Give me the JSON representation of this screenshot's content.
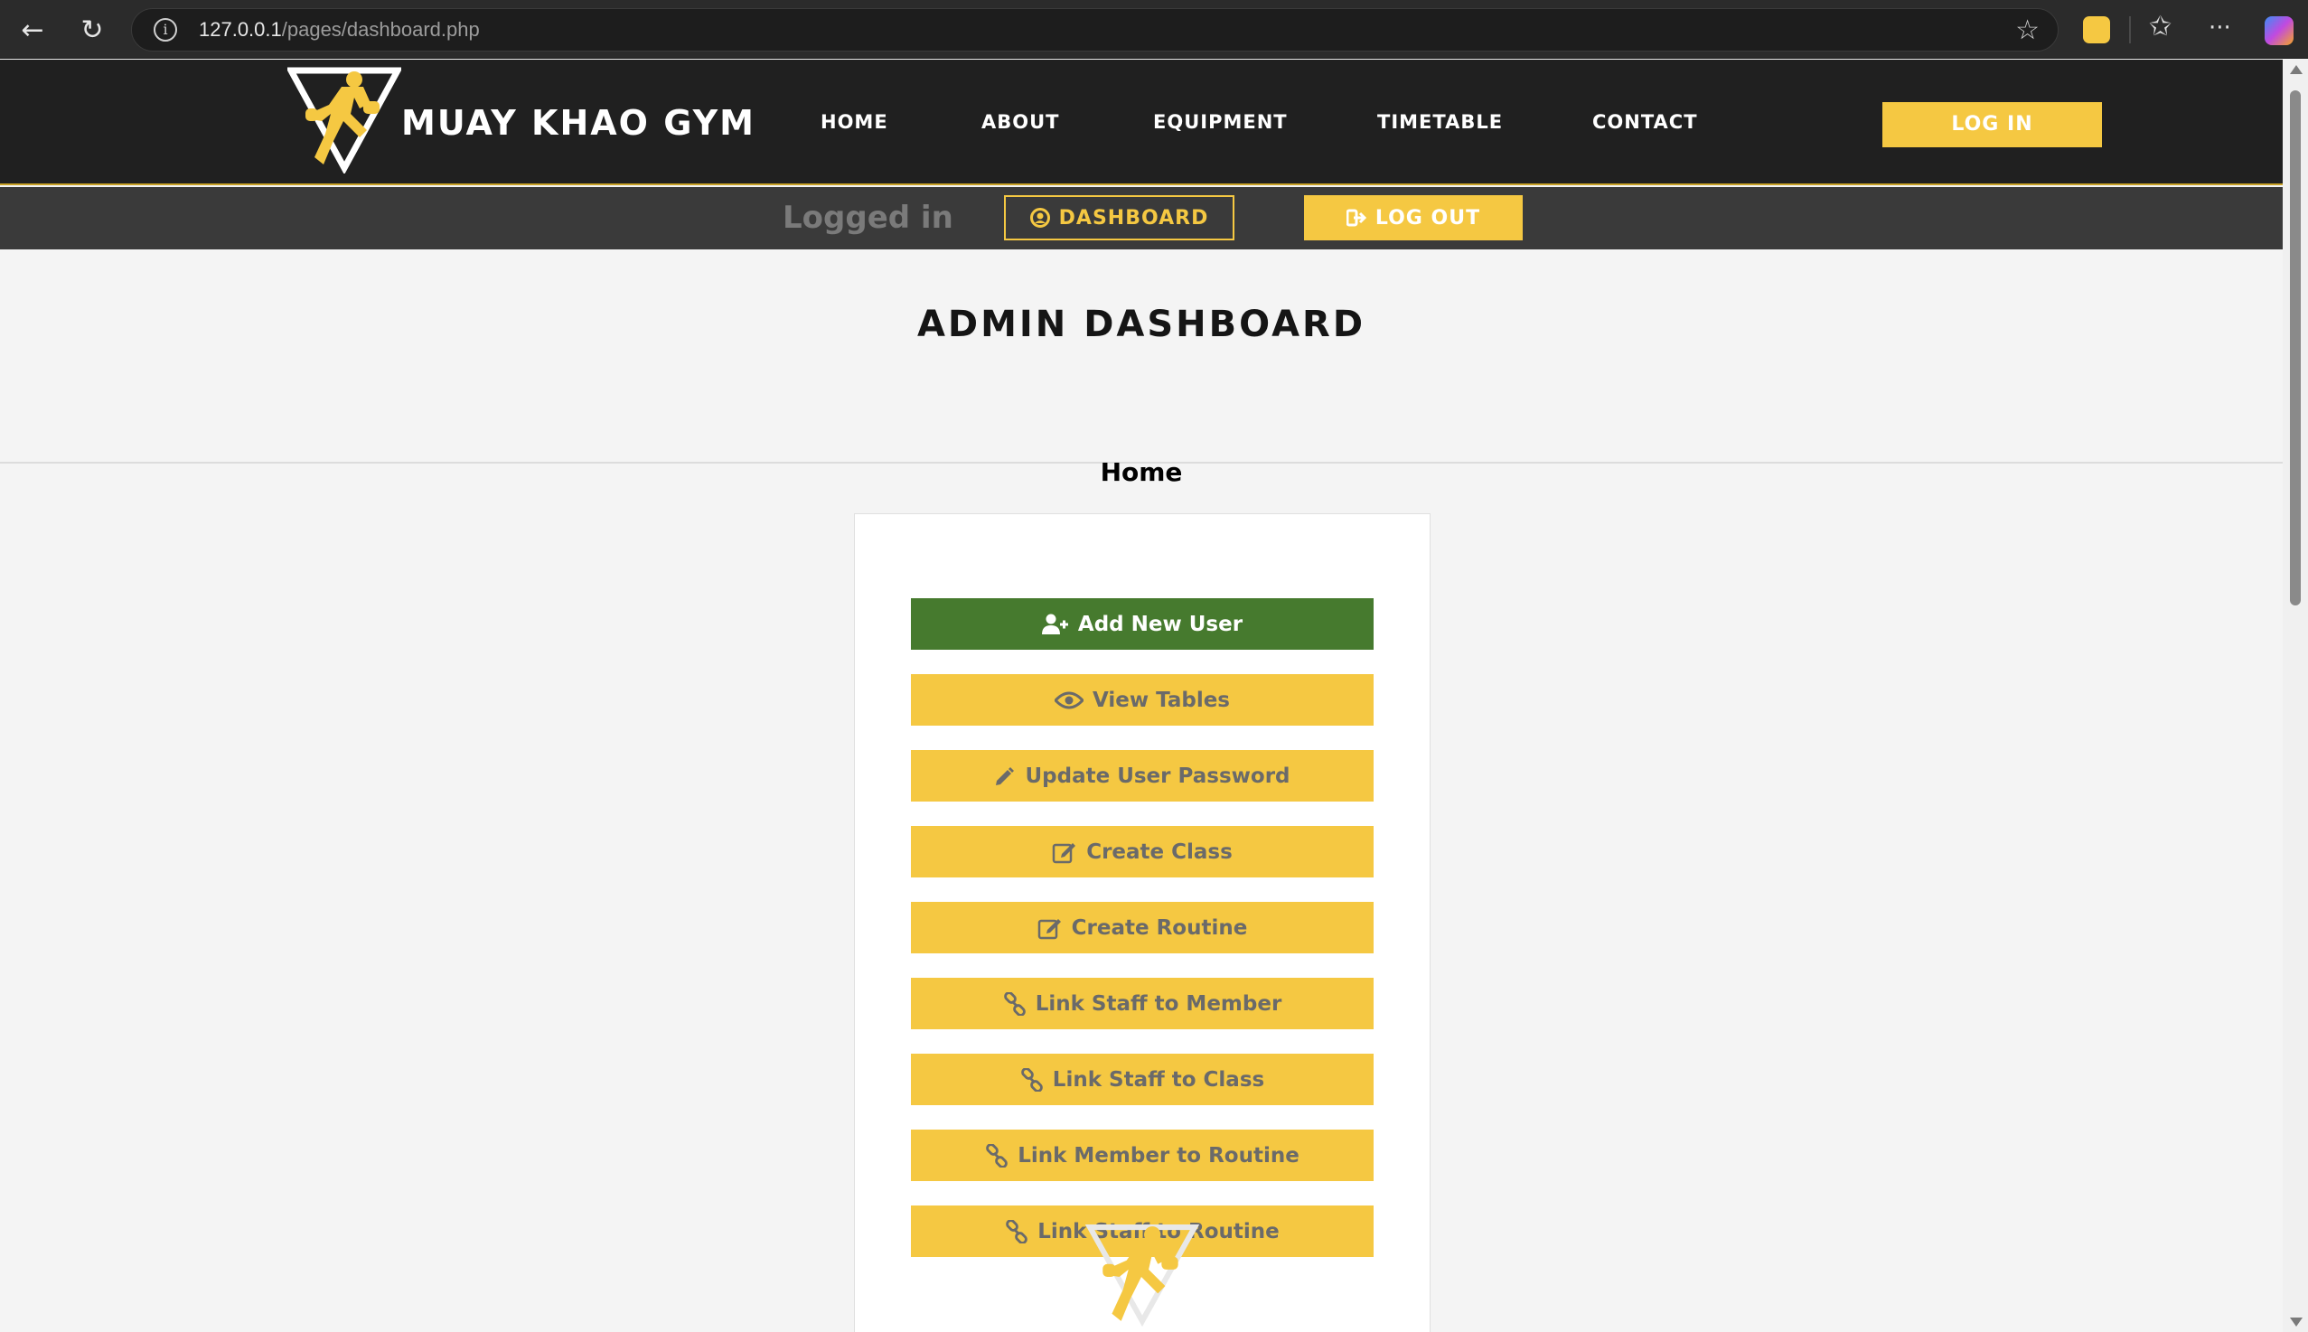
{
  "browser": {
    "url_host": "127.0.0.1",
    "url_path": "/pages/dashboard.php",
    "back_icon": "←",
    "reload_icon": "↻",
    "info_icon": "i",
    "star_icon": "☆",
    "favorites_icon": "✩",
    "more_icon": "···"
  },
  "header": {
    "brand": "MUAY KHAO GYM",
    "nav": [
      "Home",
      "About",
      "Equipment",
      "Timetable",
      "Contact"
    ],
    "login_label": "Log in"
  },
  "login_bar": {
    "status": "Logged in",
    "dashboard_label": "Dashboard",
    "logout_label": "Log out"
  },
  "main": {
    "title": "ADMIN DASHBOARD",
    "section_heading": "Home",
    "buttons": [
      {
        "label": "Add New User",
        "icon": "add-user-icon"
      },
      {
        "label": "View Tables",
        "icon": "eye-icon"
      },
      {
        "label": "Update User Password",
        "icon": "pencil-icon"
      },
      {
        "label": "Create Class",
        "icon": "edit-icon"
      },
      {
        "label": "Create Routine",
        "icon": "edit-icon"
      },
      {
        "label": "Link Staff to Member",
        "icon": "link-icon"
      },
      {
        "label": "Link Staff to Class",
        "icon": "link-icon"
      },
      {
        "label": "Link Member to Routine",
        "icon": "link-icon"
      },
      {
        "label": "Link Staff to Routine",
        "icon": "link-icon"
      }
    ]
  },
  "colors": {
    "brand_yellow": "#f5c842",
    "header_dark": "#202020",
    "add_user_green": "#467a2e"
  }
}
